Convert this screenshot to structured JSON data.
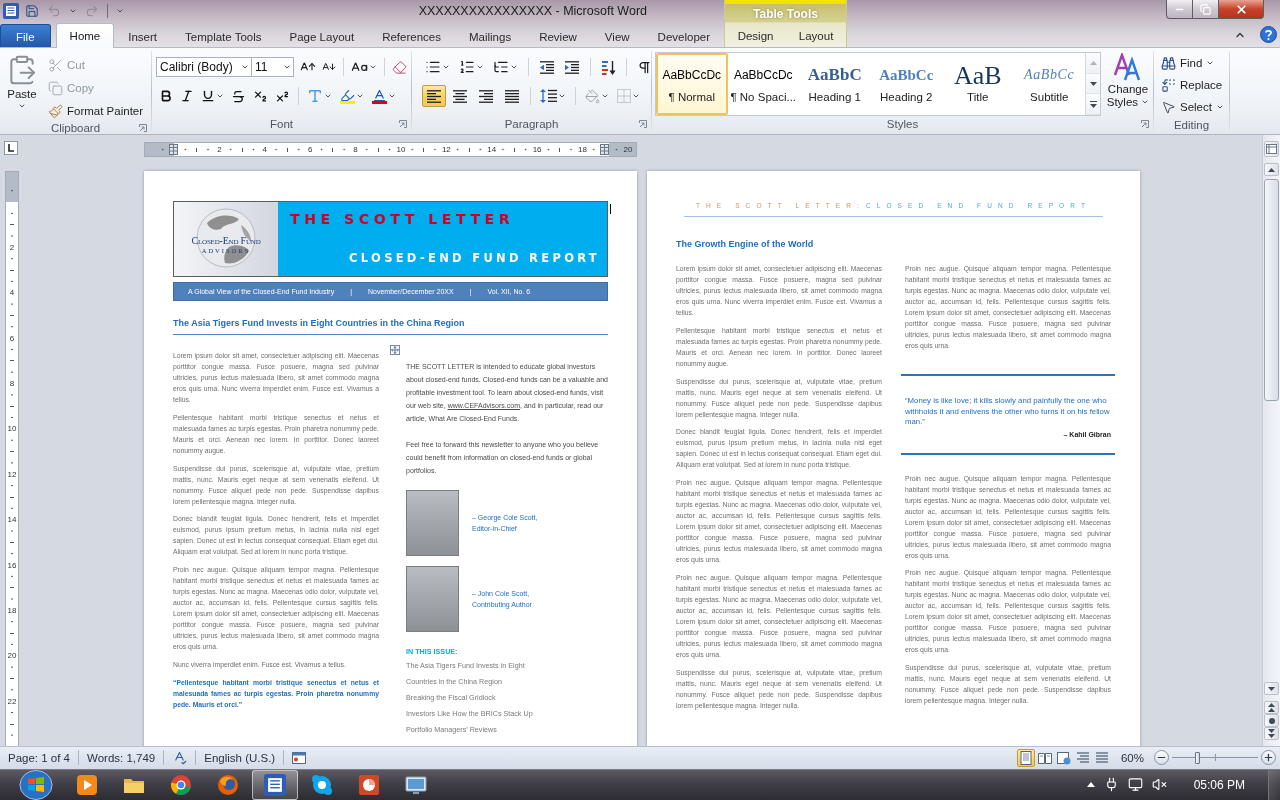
{
  "title_bar": {
    "title": "XXXXXXXXXXXXXXXX - Microsoft Word"
  },
  "contextual_group": {
    "title": "Table Tools",
    "tabs": [
      {
        "label": "Design",
        "selected": false
      },
      {
        "label": "Layout",
        "selected": false
      }
    ]
  },
  "tabs": [
    {
      "label": "File",
      "kind": "file",
      "selected": false
    },
    {
      "label": "Home",
      "kind": "tab",
      "selected": true
    },
    {
      "label": "Insert",
      "kind": "tab",
      "selected": false
    },
    {
      "label": "Template Tools",
      "kind": "tab",
      "selected": false
    },
    {
      "label": "Page Layout",
      "kind": "tab",
      "selected": false
    },
    {
      "label": "References",
      "kind": "tab",
      "selected": false
    },
    {
      "label": "Mailings",
      "kind": "tab",
      "selected": false
    },
    {
      "label": "Review",
      "kind": "tab",
      "selected": false
    },
    {
      "label": "View",
      "kind": "tab",
      "selected": false
    },
    {
      "label": "Developer",
      "kind": "tab",
      "selected": false
    }
  ],
  "clipboard": {
    "group": "Clipboard",
    "paste": "Paste",
    "actions": [
      {
        "kind": "cut",
        "label": "Cut",
        "disabled": true
      },
      {
        "kind": "copy",
        "label": "Copy",
        "disabled": true
      },
      {
        "kind": "format_painter",
        "label": "Format Painter",
        "disabled": false
      }
    ]
  },
  "font": {
    "group": "Font",
    "name": "Calibri (Body)",
    "size": "11"
  },
  "paragraph": {
    "group": "Paragraph",
    "alignments": [
      {
        "kind": "left",
        "selected": true
      },
      {
        "kind": "center",
        "selected": false
      },
      {
        "kind": "right",
        "selected": false
      },
      {
        "kind": "justify",
        "selected": false
      }
    ]
  },
  "styles": {
    "group": "Styles",
    "items": [
      {
        "kind": "normal",
        "preview": "AaBbCcDc",
        "label": "¶ Normal",
        "selected": true
      },
      {
        "kind": "no_spacing",
        "preview": "AaBbCcDc",
        "label": "¶ No Spaci...",
        "selected": false
      },
      {
        "kind": "heading1",
        "preview": "AaBbC",
        "label": "Heading 1",
        "selected": false
      },
      {
        "kind": "heading2",
        "preview": "AaBbCc",
        "label": "Heading 2",
        "selected": false
      },
      {
        "kind": "title",
        "preview": "AaB",
        "label": "Title",
        "selected": false
      },
      {
        "kind": "subtitle",
        "preview": "AaBbCc",
        "label": "Subtitle",
        "selected": false
      }
    ],
    "change": "Change Styles"
  },
  "editing": {
    "group": "Editing",
    "find": "Find",
    "replace": "Replace",
    "select": "Select"
  },
  "ruler": {
    "horizontal": [
      "2",
      "4",
      "6",
      "8",
      "10",
      "12",
      "14",
      "16",
      "18",
      "20"
    ],
    "vertical": [
      "2",
      "4",
      "6",
      "8",
      "10",
      "12",
      "14",
      "16",
      "18",
      "20",
      "22"
    ]
  },
  "page1": {
    "masthead": {
      "logo_name": "Closed-End Fund",
      "logo_sub": "ADVISORS",
      "title": "THE SCOTT LETTER",
      "subtitle": "CLOSED-END FUND REPORT"
    },
    "band": [
      "A Global View of the Closed-End Fund Industry",
      "|",
      "November/December 20XX",
      "|",
      "Vol. XII, No. 6"
    ],
    "headline": "The Asia Tigers Fund Invests in Eight Countries in the China Region",
    "left_column": [
      {
        "kind": "body",
        "text": "Lorem ipsum dolor sit amet, consectetuer adipiscing elit. Maecenas porttitor congue massa. Fusce posuere, magna sed pulvinar ultricies, purus lectus malesuada libero, sit amet commodo magna eros quis urna. Nunc viverra imperdiet enim. Fusce est. Vivamus a tellus."
      },
      {
        "kind": "body",
        "text": "Pellentesque habitant morbi tristique senectus et netus et malesuada fames ac turpis egestas. Proin pharetra nonummy pede. Mauris et orci. Aenean nec lorem. In porttitor. Donec laoreet nonummy augue."
      },
      {
        "kind": "body",
        "text": "Suspendisse dui purus, scelerisque at, vulputate vitae, pretium mattis, nunc. Mauris eget neque at sem venenatis eleifend. Ut nonummy. Fusce aliquet pede non pede. Suspendisse dapibus lorem pellentesque magna. Integer nulla."
      },
      {
        "kind": "body",
        "text": "Donec blandit feugiat ligula. Donec hendrerit, felis et imperdiet euismod, purus ipsum pretium metus, in lacinia nulla nisl eget sapien. Donec ut est in lectus consequat consequat. Etiam eget dui. Aliquam erat volutpat. Sed at lorem in nunc porta tristique."
      },
      {
        "kind": "body",
        "text": "Proin nec augue. Quisque aliquam tempor magna. Pellentesque habitant morbi tristique senectus et netus et malesuada fames ac turpis egestas. Nunc ac magna. Maecenas odio dolor, vulputate vel, auctor ac, accumsan id, felis. Pellentesque cursus sagittis felis. Lorem ipsum dolor sit amet, consectetuer adipiscing elit. Maecenas porttitor congue massa. Fusce posuere, magna sed pulvinar ultricies, purus lectus malesuada libero, sit amet commodo magna eros quis urna."
      },
      {
        "kind": "body",
        "text": "Nunc viverra imperdiet enim. Fusce est. Vivamus a tellus."
      },
      {
        "kind": "quote",
        "text": "“Pellentesque habitant morbi tristique senectus et netus et malesuada fames ac turpis egestas. Proin pharetra nonummy pede. Mauris et orci.”"
      }
    ],
    "sidebar": {
      "intro": {
        "before": "THE SCOTT LETTER is intended to educate global investors about closed-end funds. Closed-end funds can be a valuable and profitable investment tool. To learn about closed-end funds, visit our web site, ",
        "link": "www.CEFAdvisors.com",
        "after": ", and in particular, read our article, What Are Closed-End Funds."
      },
      "note": "Feel free to forward this newsletter to anyone who you believe could benefit from information on closed-end funds or global portfolios.",
      "authors": [
        {
          "caption": "– George Cole Scott, Editor-in-Chief"
        },
        {
          "caption": "– John Cole Scott, Contributing Author"
        }
      ],
      "issue_heading": "IN THIS ISSUE:",
      "issue_items": [
        "The Asia Tigers Fund Invests in Eight Countries in the China Region",
        "Breaking the Fiscal Gridlock",
        "Investors Like How the BRICs Stack Up",
        "Portfolio Managers’ Reviews"
      ]
    }
  },
  "page2": {
    "running_header": {
      "title": "THE SCOTT LETTER:",
      "subtitle": "CLOSED END FUND REPORT"
    },
    "headline": "The Growth Engine of the World",
    "left_column": [
      {
        "kind": "body",
        "text": "Lorem ipsum dolor sit amet, consectetuer adipiscing elit. Maecenas porttitor congue massa. Fusce posuere, magna sed pulvinar ultricies, purus lectus malesuada libero, sit amet commodo magna eros quis urna. Nunc viverra imperdiet enim. Fusce est. Vivamus a tellus."
      },
      {
        "kind": "body",
        "text": "Pellentesque habitant morbi tristique senectus et netus et malesuada fames ac turpis egestas. Proin pharetra nonummy pede. Mauris et orci. Aenean nec lorem. In porttitor. Donec laoreet nonummy augue."
      },
      {
        "kind": "body",
        "text": "Suspendisse dui purus, scelerisque at, vulputate vitae, pretium mattis, nunc. Mauris eget neque at sem venenatis eleifend. Ut nonummy. Fusce aliquet pede non pede. Suspendisse dapibus lorem pellentesque magna. Integer nulla."
      },
      {
        "kind": "body",
        "text": "Donec blandit feugiat ligula. Donec hendrerit, felis et imperdiet euismod, purus ipsum pretium metus, in lacinia nulla nisl eget sapien. Donec ut est in lectus consequat consequat. Etiam eget dui. Aliquam erat volutpat. Sed at lorem in nunc porta tristique."
      },
      {
        "kind": "body",
        "text": "Proin nec augue. Quisque aliquam tempor magna. Pellentesque habitant morbi tristique senectus et netus et malesuada fames ac turpis egestas. Nunc ac magna. Maecenas odio dolor, vulputate vel, auctor ac, accumsan id, felis. Pellentesque cursus sagittis felis. Lorem ipsum dolor sit amet, consectetuer adipiscing elit. Maecenas porttitor congue massa. Fusce posuere, magna sed pulvinar ultricies, purus lectus malesuada libero, sit amet commodo magna eros quis urna."
      },
      {
        "kind": "body",
        "text": "Proin nec augue. Quisque aliquam tempor magna. Pellentesque habitant morbi tristique senectus et netus et malesuada fames ac turpis egestas. Nunc ac magna. Maecenas odio dolor, vulputate vel, auctor ac, accumsan id, felis. Pellentesque cursus sagittis felis. Lorem ipsum dolor sit amet, consectetuer adipiscing elit. Maecenas porttitor congue massa. Fusce posuere, magna sed pulvinar ultricies, purus lectus malesuada libero, sit amet commodo magna eros quis urna."
      },
      {
        "kind": "body",
        "text": "Suspendisse dui purus, scelerisque at, vulputate vitae, pretium mattis, nunc. Mauris eget neque at sem venenatis eleifend. Ut nonummy. Fusce aliquet pede non pede. Suspendisse dapibus lorem pellentesque magna. Integer nulla."
      }
    ],
    "right_column": [
      {
        "kind": "body",
        "text": "Proin nec augue. Quisque aliquam tempor magna. Pellentesque habitant morbi tristique senectus et netus et malesuada fames ac turpis egestas. Nunc ac magna. Maecenas odio dolor, vulputate vel, auctor ac, accumsan id, felis. Pellentesque cursus sagittis felis. Lorem ipsum dolor sit amet, consectetuer adipiscing elit. Maecenas porttitor congue massa. Fusce posuere, magna sed pulvinar ultricies, purus lectus malesuada libero, sit amet commodo magna eros quis urna."
      },
      {
        "kind": "pull_quote",
        "text": "“Money is like love; it kills slowly and painfully the one who withholds it and enlivens the other who turns it on his fellow man.”",
        "attribution": "– Kahil Gibran"
      },
      {
        "kind": "body",
        "text": "Proin nec augue. Quisque aliquam tempor magna. Pellentesque habitant morbi tristique senectus et netus et malesuada fames ac turpis egestas. Nunc ac magna. Maecenas odio dolor, vulputate vel, auctor ac, accumsan id, felis. Pellentesque cursus sagittis felis. Lorem ipsum dolor sit amet, consectetuer adipiscing elit. Maecenas porttitor congue massa. Fusce posuere, magna sed pulvinar ultricies, purus lectus malesuada libero, sit amet commodo magna eros quis urna."
      },
      {
        "kind": "body",
        "text": "Proin nec augue. Quisque aliquam tempor magna. Pellentesque habitant morbi tristique senectus et netus et malesuada fames ac turpis egestas. Nunc ac magna. Maecenas odio dolor, vulputate vel, auctor ac, accumsan id, felis. Pellentesque cursus sagittis felis. Lorem ipsum dolor sit amet, consectetuer adipiscing elit. Maecenas porttitor congue massa. Fusce posuere, magna sed pulvinar ultricies, purus lectus malesuada libero, sit amet commodo magna eros quis urna."
      },
      {
        "kind": "body",
        "text": "Suspendisse dui purus, scelerisque at, vulputate vitae, pretium mattis, nunc. Mauris eget neque at sem venenatis eleifend. Ut nonummy. Fusce aliquet pede non pede. Suspendisse dapibus lorem pellentesque magna. Integer nulla."
      }
    ]
  },
  "status_bar": {
    "page": "Page: 1 of 4",
    "words": "Words: 1,749",
    "language": "English (U.S.)",
    "views": [
      {
        "kind": "print_layout",
        "selected": true
      },
      {
        "kind": "full_screen",
        "selected": false
      },
      {
        "kind": "web_layout",
        "selected": false
      },
      {
        "kind": "outline",
        "selected": false
      },
      {
        "kind": "draft",
        "selected": false
      }
    ],
    "zoom": "60%",
    "zoom_slider": {
      "level": 0.3
    }
  },
  "taskbar": {
    "apps": [
      {
        "kind": "media",
        "selected": false
      },
      {
        "kind": "folder",
        "selected": false
      },
      {
        "kind": "chrome",
        "selected": false
      },
      {
        "kind": "firefox",
        "selected": false
      },
      {
        "kind": "word",
        "selected": true
      },
      {
        "kind": "skype",
        "selected": false
      },
      {
        "kind": "powerpoint",
        "selected": false
      },
      {
        "kind": "screen",
        "selected": false
      }
    ],
    "clock": "05:06 PM"
  }
}
